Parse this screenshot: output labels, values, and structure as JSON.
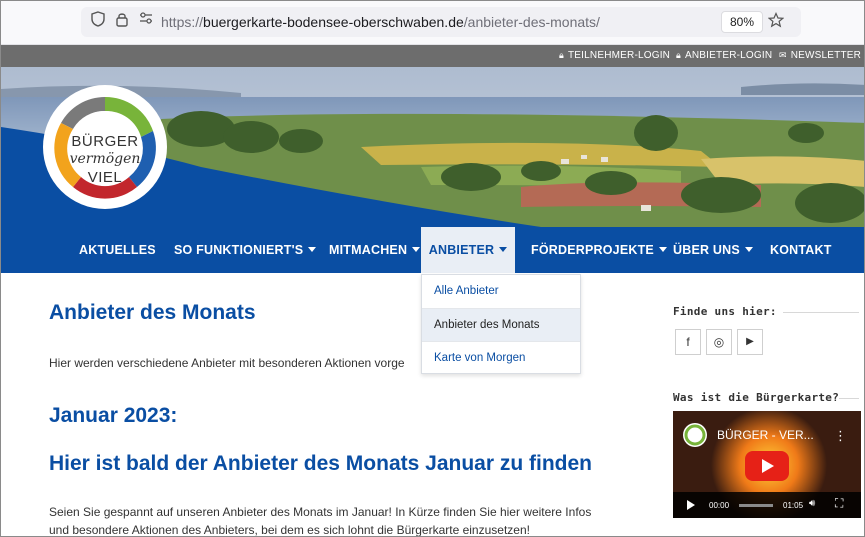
{
  "browser": {
    "url_prefix": "https://",
    "url_domain": "buergerkarte-bodensee-oberschwaben.de",
    "url_path": "/anbieter-des-monats/",
    "zoom": "80%",
    "icons": {
      "shield": "shield-icon",
      "lock": "lock-icon",
      "permissions": "permissions-icon",
      "bookmark": "star-icon"
    }
  },
  "topbar": {
    "links": [
      {
        "label": "TEILNEHMER-LOGIN",
        "icon": "lock-icon"
      },
      {
        "label": "ANBIETER-LOGIN",
        "icon": "lock-icon"
      },
      {
        "label": "NEWSLETTER",
        "icon": "envelope-icon"
      }
    ]
  },
  "logo": {
    "line1": "BÜRGER",
    "line2": "vermögen",
    "line3": "VIEL"
  },
  "nav": {
    "items": [
      {
        "label": "AKTUELLES",
        "has_dropdown": false
      },
      {
        "label": "SO FUNKTIONIERT'S",
        "has_dropdown": true
      },
      {
        "label": "MITMACHEN",
        "has_dropdown": true
      },
      {
        "label": "ANBIETER",
        "has_dropdown": true,
        "active": true
      },
      {
        "label": "FÖRDERPROJEKTE",
        "has_dropdown": true
      },
      {
        "label": "ÜBER UNS",
        "has_dropdown": true
      },
      {
        "label": "KONTAKT",
        "has_dropdown": false
      }
    ],
    "dropdown": [
      {
        "label": "Alle Anbieter"
      },
      {
        "label": "Anbieter des Monats",
        "selected": true
      },
      {
        "label": "Karte von Morgen"
      }
    ]
  },
  "main": {
    "title": "Anbieter des Monats",
    "intro": "Hier werden verschiedene Anbieter mit besonderen Aktionen vorge",
    "month": "Januar 2023:",
    "subheading": "Hier ist bald der Anbieter des Monats Januar zu finden",
    "paragraph_line1": "Seien Sie gespannt auf unseren Anbieter des Monats im Januar! In Kürze finden Sie hier weitere Infos",
    "paragraph_line2": "und besondere Aktionen des Anbieters, bei dem es sich lohnt die Bürgerkarte einzusetzen!"
  },
  "sidebar": {
    "find_us": "Finde uns hier:",
    "social": [
      {
        "icon": "facebook-icon",
        "glyph": "f"
      },
      {
        "icon": "instagram-icon",
        "glyph": "◎"
      },
      {
        "icon": "youtube-icon",
        "glyph": "▶"
      }
    ],
    "what_is": "Was ist die Bürgerkarte?",
    "video": {
      "title": "BÜRGER - VER...",
      "time_current": "00:00",
      "time_total": "01:05"
    }
  },
  "colors": {
    "brand_blue": "#0a4ea3",
    "topbar_gray": "#6d6d6d",
    "youtube_red": "#e62117"
  }
}
